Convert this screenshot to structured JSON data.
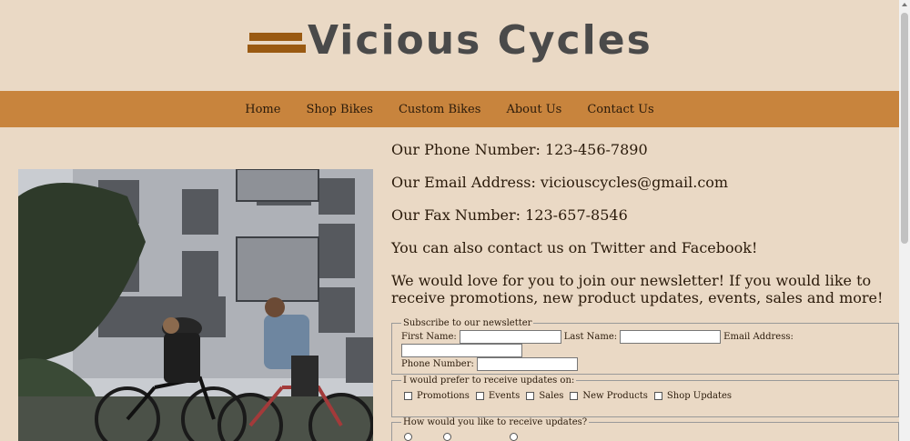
{
  "brand": {
    "name": "Vicious Cycles"
  },
  "nav": [
    {
      "label": "Home"
    },
    {
      "label": "Shop Bikes"
    },
    {
      "label": "Custom Bikes"
    },
    {
      "label": "About Us"
    },
    {
      "label": "Contact Us"
    }
  ],
  "contact": {
    "phone": "Our Phone Number: 123-456-7890",
    "email": "Our Email Address: viciouscycles@gmail.com",
    "fax": "Our Fax Number: 123-657-8546",
    "social": "You can also contact us on Twitter and Facebook!",
    "newsletter": "We would love for you to join our newsletter! If you would like to receive promotions, new product updates, events, sales and more!"
  },
  "form": {
    "subscribe_legend": "Subscribe to our newsletter",
    "first_name_label": "First Name:",
    "last_name_label": "Last Name:",
    "email_label": "Email Address:",
    "phone_label": "Phone Number:",
    "updates_legend": "I would prefer to receive updates on:",
    "updates": [
      "Promotions",
      "Events",
      "Sales",
      "New Products",
      "Shop Updates"
    ],
    "method_legend": "How would you like to receive updates?"
  },
  "colors": {
    "background": "#ead9c5",
    "nav": "#c8843d",
    "logo_mark": "#9a5a12",
    "logo_text": "#4a4a4a"
  }
}
